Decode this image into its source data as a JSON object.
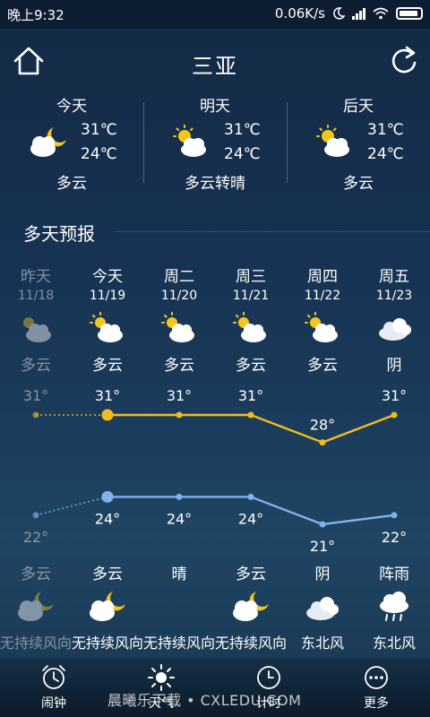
{
  "status_bar": {
    "time": "晚上9:32",
    "speed": "0.06K/s"
  },
  "header": {
    "city": "三亚",
    "home_icon": "home-icon",
    "refresh_icon": "refresh-icon"
  },
  "summary": [
    {
      "name": "今天",
      "high": "31℃",
      "low": "24℃",
      "condition": "多云",
      "icon": "partly-cloudy-night"
    },
    {
      "name": "明天",
      "high": "31℃",
      "low": "24℃",
      "condition": "多云转晴",
      "icon": "partly-cloudy-day"
    },
    {
      "name": "后天",
      "high": "31℃",
      "low": "24℃",
      "condition": "多云",
      "icon": "partly-cloudy-day"
    }
  ],
  "forecast_title": "多天预报",
  "forecast": [
    {
      "name": "昨天",
      "date": "11/18",
      "day_condition": "多云",
      "high": "31°",
      "low": "22°",
      "night_condition": "多云",
      "wind": "无持续风向",
      "past": true
    },
    {
      "name": "今天",
      "date": "11/19",
      "day_condition": "多云",
      "high": "31°",
      "low": "24°",
      "night_condition": "多云",
      "wind": "无持续风向",
      "past": false
    },
    {
      "name": "周二",
      "date": "11/20",
      "day_condition": "多云",
      "high": "31°",
      "low": "24°",
      "night_condition": "晴",
      "wind": "无持续风向",
      "past": false
    },
    {
      "name": "周三",
      "date": "11/21",
      "day_condition": "多云",
      "high": "31°",
      "low": "24°",
      "night_condition": "多云",
      "wind": "无持续风向",
      "past": false
    },
    {
      "name": "周四",
      "date": "11/22",
      "day_condition": "多云",
      "high": "28°",
      "low": "21°",
      "night_condition": "阴",
      "wind": "东北风",
      "past": false
    },
    {
      "name": "周五",
      "date": "11/23",
      "day_condition": "阴",
      "high": "31°",
      "low": "22°",
      "night_condition": "阵雨",
      "wind": "东北风",
      "past": false
    }
  ],
  "chart_data": {
    "type": "line",
    "categories": [
      "昨天",
      "今天",
      "周二",
      "周三",
      "周四",
      "周五"
    ],
    "series": [
      {
        "values": [
          31,
          31,
          31,
          31,
          28,
          31
        ],
        "color": "#f2bd1d"
      },
      {
        "values": [
          22,
          24,
          24,
          24,
          21,
          22
        ],
        "color": "#7fb2f0"
      }
    ]
  },
  "bottom_nav": [
    {
      "label": "闹钟",
      "icon": "alarm-clock-icon"
    },
    {
      "label": "天气",
      "icon": "sun-icon"
    },
    {
      "label": "计时",
      "icon": "timer-icon"
    },
    {
      "label": "更多",
      "icon": "more-icon"
    }
  ],
  "watermark": "晨曦乐下载 • CXLEDU.COM"
}
